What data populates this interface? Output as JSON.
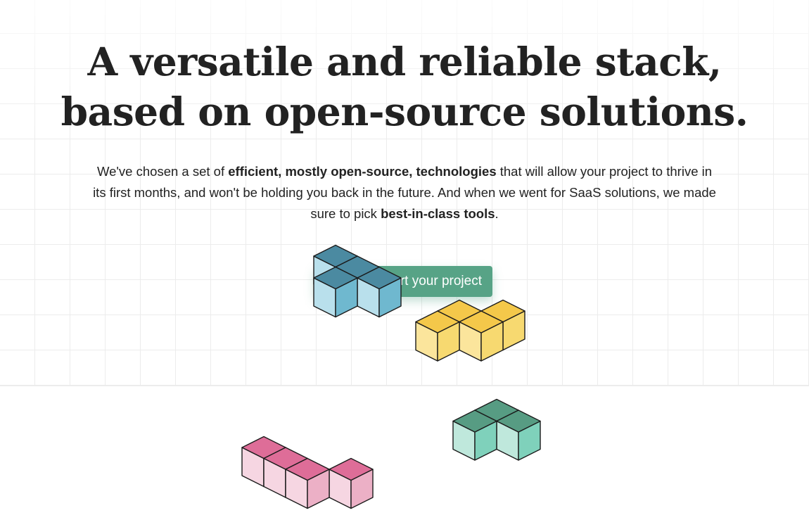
{
  "hero": {
    "title_line1": "A versatile and reliable stack,",
    "title_line2": "based on open-source solutions.",
    "paragraph": {
      "part1": "We've chosen a set of ",
      "bold1": "efficient, mostly open-source, technologies",
      "part2": " that will allow your project to thrive in its first months, and won't be holding you back in the future. And when we went for SaaS solutions, we made sure to pick ",
      "bold2": "best-in-class tools",
      "part3": "."
    },
    "cta_label": "Start your project"
  },
  "decorations": {
    "blocks": [
      {
        "name": "blue-tetromino",
        "top": "#4b8aa1",
        "left": "#b9e0ec",
        "right": "#6fb8cf"
      },
      {
        "name": "yellow-tetromino",
        "top": "#f4c84a",
        "left": "#fbe59c",
        "right": "#f7d970"
      },
      {
        "name": "green-tetromino",
        "top": "#579c83",
        "left": "#bfe8dc",
        "right": "#7fd1bb"
      },
      {
        "name": "pink-tetromino",
        "top": "#de6d98",
        "left": "#f6d6e2",
        "right": "#ecb0c6"
      }
    ]
  },
  "colors": {
    "accent": "#57a386",
    "grid_line": "#ececec",
    "text": "#222222"
  }
}
